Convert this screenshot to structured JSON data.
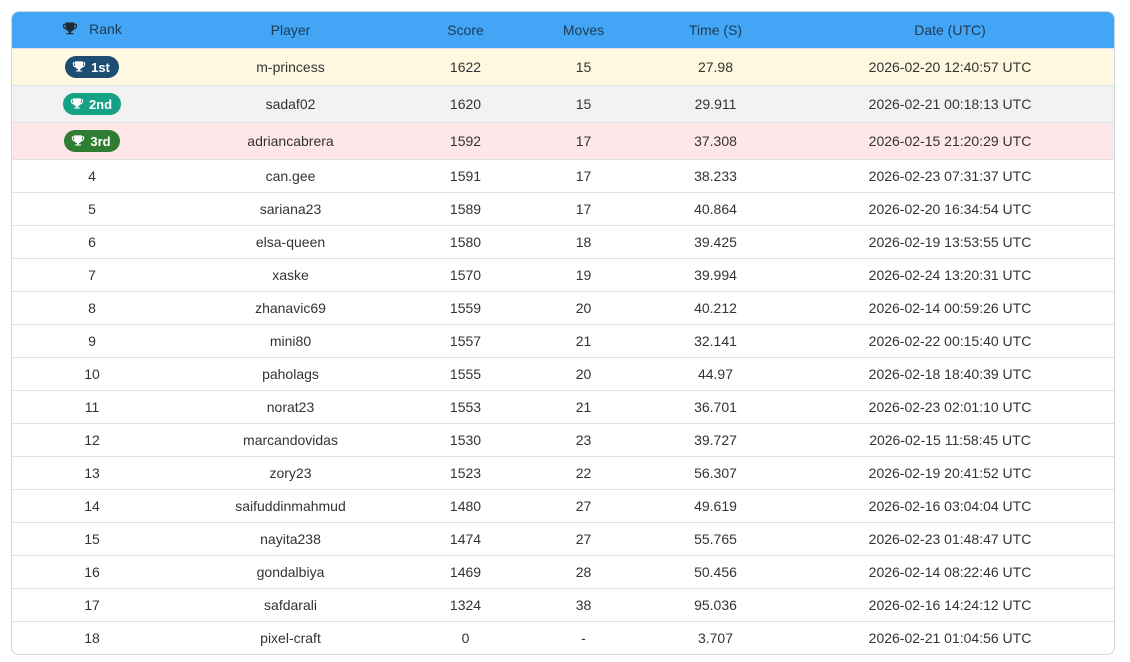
{
  "colors": {
    "header_bg": "#42a5f5",
    "header_text": "#1f3a52",
    "row_first_bg": "#fff8e1",
    "row_second_bg": "#f2f2f2",
    "row_third_bg": "#fde7e9",
    "badge_first": "#1e4d72",
    "badge_second": "#16a085",
    "badge_third": "#2e7d32"
  },
  "header": {
    "rank_icon": "trophy-icon",
    "rank": "Rank",
    "player": "Player",
    "score": "Score",
    "moves": "Moves",
    "time": "Time (S)",
    "date": "Date (UTC)"
  },
  "top_rows": [
    {
      "rank": "1st",
      "player": "m-princess",
      "score": "1622",
      "moves": "15",
      "time": "27.98",
      "date": "2026-02-20 12:40:57 UTC"
    },
    {
      "rank": "2nd",
      "player": "sadaf02",
      "score": "1620",
      "moves": "15",
      "time": "29.911",
      "date": "2026-02-21 00:18:13 UTC"
    },
    {
      "rank": "3rd",
      "player": "adriancabrera",
      "score": "1592",
      "moves": "17",
      "time": "37.308",
      "date": "2026-02-15 21:20:29 UTC"
    }
  ],
  "rows": [
    {
      "rank": "4",
      "player": "can.gee",
      "score": "1591",
      "moves": "17",
      "time": "38.233",
      "date": "2026-02-23 07:31:37 UTC"
    },
    {
      "rank": "5",
      "player": "sariana23",
      "score": "1589",
      "moves": "17",
      "time": "40.864",
      "date": "2026-02-20 16:34:54 UTC"
    },
    {
      "rank": "6",
      "player": "elsa-queen",
      "score": "1580",
      "moves": "18",
      "time": "39.425",
      "date": "2026-02-19 13:53:55 UTC"
    },
    {
      "rank": "7",
      "player": "xaske",
      "score": "1570",
      "moves": "19",
      "time": "39.994",
      "date": "2026-02-24 13:20:31 UTC"
    },
    {
      "rank": "8",
      "player": "zhanavic69",
      "score": "1559",
      "moves": "20",
      "time": "40.212",
      "date": "2026-02-14 00:59:26 UTC"
    },
    {
      "rank": "9",
      "player": "mini80",
      "score": "1557",
      "moves": "21",
      "time": "32.141",
      "date": "2026-02-22 00:15:40 UTC"
    },
    {
      "rank": "10",
      "player": "paholags",
      "score": "1555",
      "moves": "20",
      "time": "44.97",
      "date": "2026-02-18 18:40:39 UTC"
    },
    {
      "rank": "11",
      "player": "norat23",
      "score": "1553",
      "moves": "21",
      "time": "36.701",
      "date": "2026-02-23 02:01:10 UTC"
    },
    {
      "rank": "12",
      "player": "marcandovidas",
      "score": "1530",
      "moves": "23",
      "time": "39.727",
      "date": "2026-02-15 11:58:45 UTC"
    },
    {
      "rank": "13",
      "player": "zory23",
      "score": "1523",
      "moves": "22",
      "time": "56.307",
      "date": "2026-02-19 20:41:52 UTC"
    },
    {
      "rank": "14",
      "player": "saifuddinmahmud",
      "score": "1480",
      "moves": "27",
      "time": "49.619",
      "date": "2026-02-16 03:04:04 UTC"
    },
    {
      "rank": "15",
      "player": "nayita238",
      "score": "1474",
      "moves": "27",
      "time": "55.765",
      "date": "2026-02-23 01:48:47 UTC"
    },
    {
      "rank": "16",
      "player": "gondalbiya",
      "score": "1469",
      "moves": "28",
      "time": "50.456",
      "date": "2026-02-14 08:22:46 UTC"
    },
    {
      "rank": "17",
      "player": "safdarali",
      "score": "1324",
      "moves": "38",
      "time": "95.036",
      "date": "2026-02-16 14:24:12 UTC"
    },
    {
      "rank": "18",
      "player": "pixel-craft",
      "score": "0",
      "moves": "-",
      "time": "3.707",
      "date": "2026-02-21 01:04:56 UTC"
    }
  ]
}
